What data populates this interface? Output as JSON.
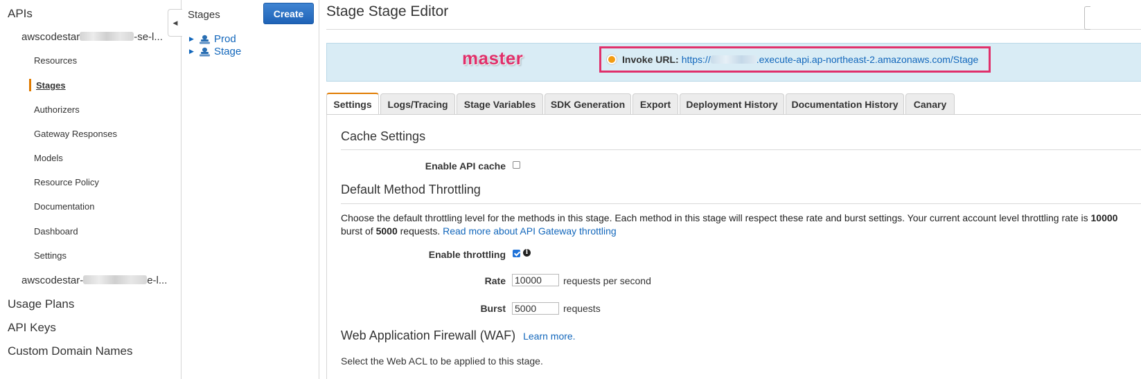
{
  "nav": {
    "apis_label": "APIs",
    "api1_prefix": "awscodestar",
    "api1_suffix": "-se-l...",
    "sub_items": [
      "Resources",
      "Stages",
      "Authorizers",
      "Gateway Responses",
      "Models",
      "Resource Policy",
      "Documentation",
      "Dashboard",
      "Settings"
    ],
    "api2_prefix": "awscodestar-",
    "api2_suffix": "e-l...",
    "bottom_items": [
      "Usage Plans",
      "API Keys",
      "Custom Domain Names"
    ]
  },
  "stages_panel": {
    "title": "Stages",
    "create_label": "Create",
    "items": [
      "Prod",
      "Stage"
    ]
  },
  "main": {
    "title": "Stage Stage Editor",
    "banner": {
      "branch_badge": "master",
      "invoke_label": "Invoke URL:",
      "url_prefix": "https://",
      "url_suffix": ".execute-api.ap-northeast-2.amazonaws.com/Stage"
    },
    "tabs": [
      "Settings",
      "Logs/Tracing",
      "Stage Variables",
      "SDK Generation",
      "Export",
      "Deployment History",
      "Documentation History",
      "Canary"
    ],
    "active_tab": "Settings",
    "cache": {
      "heading": "Cache Settings",
      "enable_label": "Enable API cache",
      "enabled": false
    },
    "throttling": {
      "heading": "Default Method Throttling",
      "desc_part1": "Choose the default throttling level for the methods in this stage. Each method in this stage will respect these rate and burst settings. Your current account level throttling rate is ",
      "account_rate": "10000",
      "desc_part2": "burst of ",
      "account_burst": "5000",
      "desc_part3": " requests. ",
      "read_more": "Read more about API Gateway throttling",
      "enable_label": "Enable throttling",
      "enabled": true,
      "rate_label": "Rate",
      "rate_value": "10000",
      "rate_suffix": "requests per second",
      "burst_label": "Burst",
      "burst_value": "5000",
      "burst_suffix": "requests"
    },
    "waf": {
      "heading": "Web Application Firewall (WAF)",
      "learn_more": "Learn more.",
      "desc": "Select the Web ACL to be applied to this stage."
    }
  },
  "colors": {
    "accent": "#e07b00",
    "link": "#1166bb",
    "highlight": "#e0306b",
    "banner": "#d9ecf5"
  }
}
